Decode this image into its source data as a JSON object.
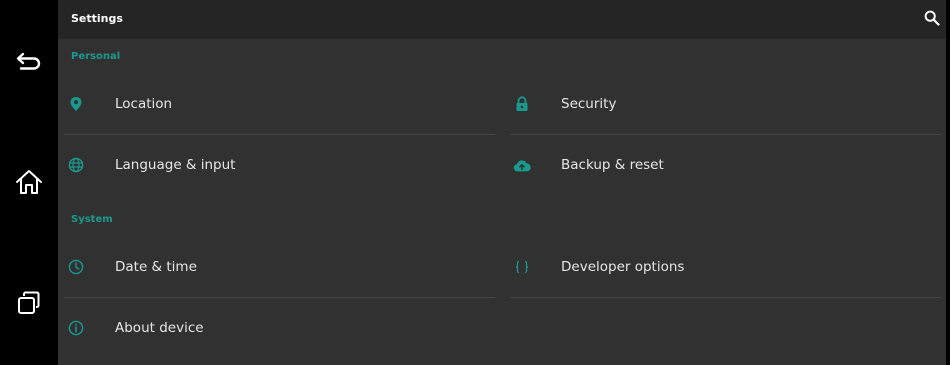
{
  "app": {
    "title": "Settings"
  },
  "colors": {
    "accent": "#1a9a8e",
    "panel_background": "#313131",
    "action_bar_background": "#252525",
    "nav_background": "#000000"
  },
  "nav": {
    "buttons": [
      {
        "icon": "back-icon"
      },
      {
        "icon": "home-icon"
      },
      {
        "icon": "recents-icon"
      }
    ]
  },
  "actionbar": {
    "search_icon": "search-icon"
  },
  "sections": {
    "personal": {
      "header": "Personal",
      "items": [
        {
          "label": "Location",
          "icon": "location-pin-icon"
        },
        {
          "label": "Security",
          "icon": "lock-icon"
        },
        {
          "label": "Language & input",
          "icon": "globe-icon"
        },
        {
          "label": "Backup & reset",
          "icon": "cloud-upload-icon"
        }
      ]
    },
    "system": {
      "header": "System",
      "items": [
        {
          "label": "Date & time",
          "icon": "clock-icon"
        },
        {
          "label": "Developer options",
          "icon": "braces-icon"
        },
        {
          "label": "About device",
          "icon": "info-icon"
        }
      ]
    }
  }
}
